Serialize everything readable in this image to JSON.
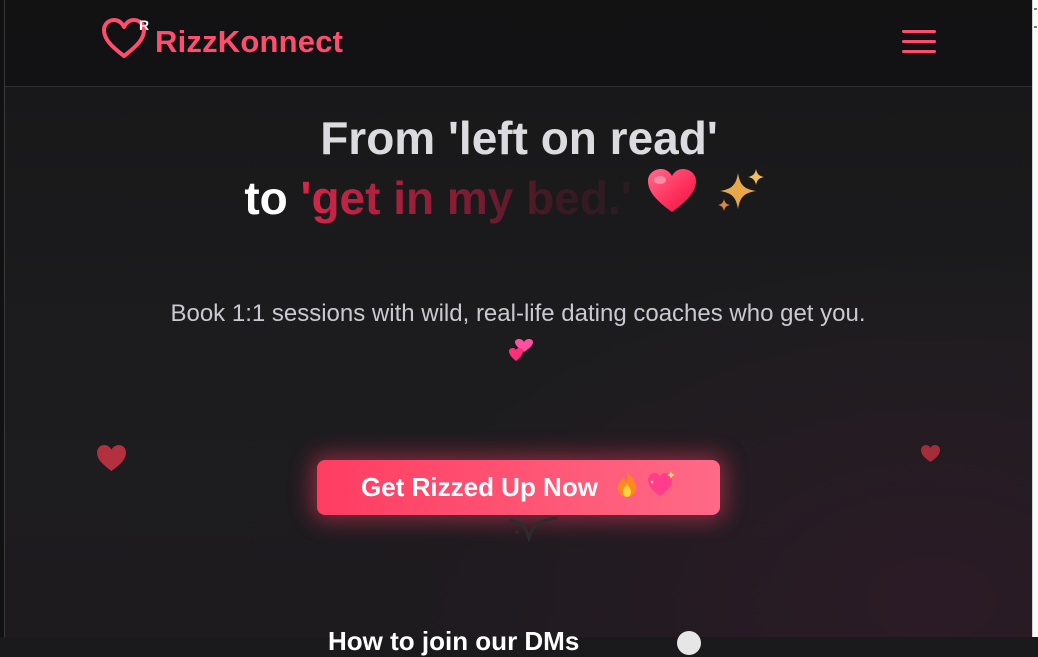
{
  "header": {
    "brand": "RizzKonnect",
    "logo_mark": "R",
    "menu_icon": "hamburger-icon"
  },
  "hero": {
    "line1": "From 'left on read'",
    "line2_prefix": "to",
    "line2_highlight": "'get in my bed.'",
    "emoji_heart": "red-heart-icon",
    "emoji_sparkle": "sparkles-icon",
    "subtitle": "Book 1:1 sessions with wild, real-life dating coaches who get you.",
    "subtitle_emoji": "two-hearts-icon"
  },
  "cta": {
    "label": "Get Rizzed Up Now",
    "icons": [
      "fire-icon",
      "sparkling-heart-icon"
    ]
  },
  "next_section": {
    "heading": "How to join our DMs"
  },
  "colors": {
    "accent": "#ff4d6d",
    "background": "#1a1a1c",
    "text": "#ffffff",
    "subtitle": "#c9c9cf"
  }
}
